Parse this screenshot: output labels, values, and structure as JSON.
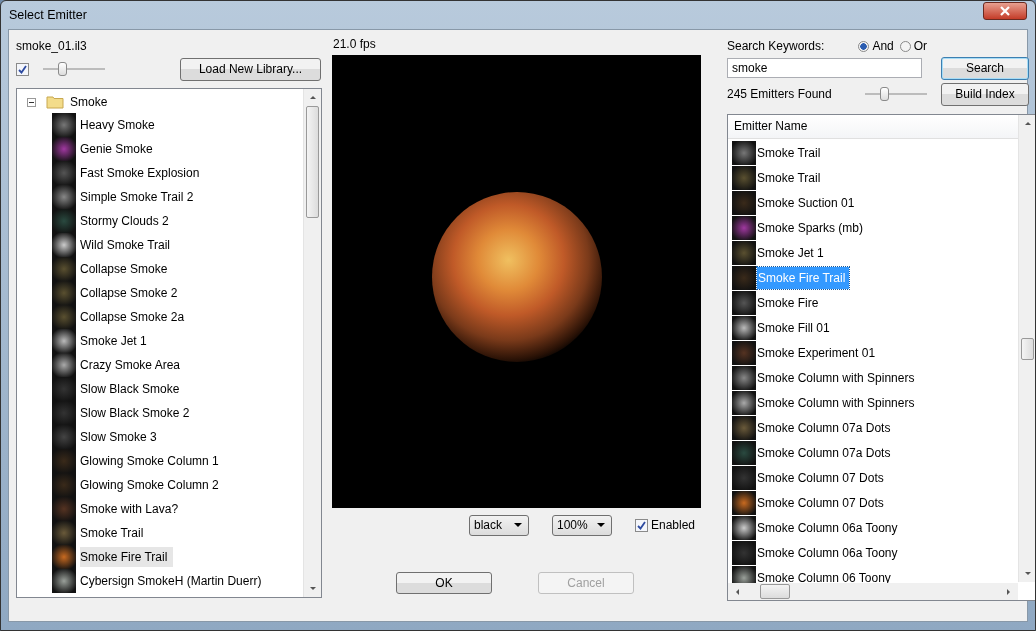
{
  "window": {
    "title": "Select Emitter"
  },
  "library": {
    "file": "smoke_01.il3",
    "thumbnails_checked": true,
    "thumb_size": {
      "level": 0.28
    },
    "load_button": "Load New Library..."
  },
  "tree": {
    "folder": "Smoke",
    "expanded": true,
    "children": [
      {
        "label": "Heavy Smoke",
        "selected": false
      },
      {
        "label": "Genie Smoke",
        "selected": false
      },
      {
        "label": "Fast Smoke Explosion",
        "selected": false
      },
      {
        "label": "Simple Smoke Trail 2",
        "selected": false
      },
      {
        "label": "Stormy Clouds 2",
        "selected": false
      },
      {
        "label": "Wild Smoke Trail",
        "selected": false
      },
      {
        "label": "Collapse Smoke",
        "selected": false
      },
      {
        "label": "Collapse Smoke 2",
        "selected": false
      },
      {
        "label": "Collapse Smoke 2a",
        "selected": false
      },
      {
        "label": "Smoke Jet 1",
        "selected": false
      },
      {
        "label": "Crazy Smoke Area",
        "selected": false
      },
      {
        "label": "Slow Black Smoke",
        "selected": false
      },
      {
        "label": "Slow Black Smoke 2",
        "selected": false
      },
      {
        "label": "Slow Smoke 3",
        "selected": false
      },
      {
        "label": "Glowing Smoke Column 1",
        "selected": false
      },
      {
        "label": "Glowing Smoke Column 2",
        "selected": false
      },
      {
        "label": "Smoke with Lava?",
        "selected": false
      },
      {
        "label": "Smoke Trail",
        "selected": false
      },
      {
        "label": "Smoke Fire Trail",
        "selected": true
      },
      {
        "label": "Cybersign SmokeH (Martin Duerr)",
        "selected": false
      }
    ]
  },
  "preview": {
    "fps": "21.0 fps",
    "background": "black",
    "zoom": "100%",
    "enabled_label": "Enabled",
    "enabled": true
  },
  "search": {
    "label": "Search Keywords:",
    "modes": [
      {
        "label": "And",
        "selected": true
      },
      {
        "label": "Or",
        "selected": false
      }
    ],
    "value": "smoke",
    "button": "Search",
    "found": "245 Emitters Found",
    "size": {
      "level": 0.28
    },
    "build_button": "Build Index"
  },
  "results": {
    "column": "Emitter Name",
    "rows": [
      {
        "label": "Smoke Trail",
        "selected": false
      },
      {
        "label": "Smoke Trail",
        "selected": false
      },
      {
        "label": "Smoke Suction 01",
        "selected": false
      },
      {
        "label": "Smoke Sparks (mb)",
        "selected": false
      },
      {
        "label": "Smoke Jet 1",
        "selected": false
      },
      {
        "label": "Smoke Fire Trail",
        "selected": true
      },
      {
        "label": "Smoke Fire",
        "selected": false
      },
      {
        "label": "Smoke Fill 01",
        "selected": false
      },
      {
        "label": "Smoke Experiment 01",
        "selected": false
      },
      {
        "label": "Smoke Column with Spinners",
        "selected": false
      },
      {
        "label": "Smoke Column with Spinners",
        "selected": false
      },
      {
        "label": "Smoke Column 07a Dots",
        "selected": false
      },
      {
        "label": "Smoke Column 07a Dots",
        "selected": false
      },
      {
        "label": "Smoke Column 07 Dots",
        "selected": false
      },
      {
        "label": "Smoke Column 07 Dots",
        "selected": false
      },
      {
        "label": "Smoke Column 06a Toony",
        "selected": false
      },
      {
        "label": "Smoke Column 06a Toony",
        "selected": false
      },
      {
        "label": "Smoke Column 06 Toony",
        "selected": false
      }
    ]
  },
  "buttons": [
    {
      "label": "OK",
      "disabled": false
    },
    {
      "label": "Cancel",
      "disabled": true
    }
  ]
}
